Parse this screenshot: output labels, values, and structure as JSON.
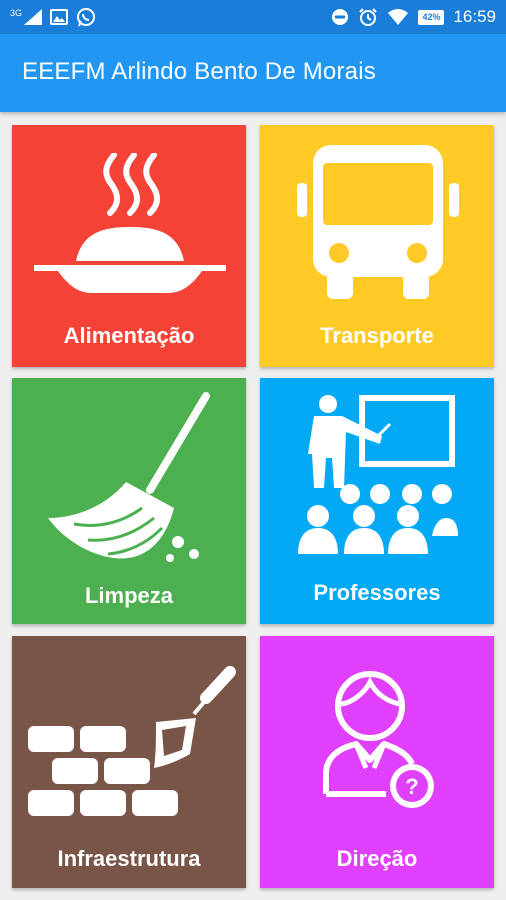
{
  "status_bar": {
    "network": "3G",
    "battery": "42%",
    "time": "16:59",
    "icons": [
      "signal-icon",
      "image-notification-icon",
      "whatsapp-icon",
      "do-not-disturb-icon",
      "alarm-icon",
      "wifi-icon",
      "battery-icon"
    ]
  },
  "app_bar": {
    "title": "EEEFM Arlindo Bento De Morais",
    "color": "#2196f3"
  },
  "tiles": [
    {
      "label": "Alimentação",
      "color": "#f44336",
      "icon": "food-plate-icon"
    },
    {
      "label": "Transporte",
      "color": "#ffc926",
      "icon": "bus-icon"
    },
    {
      "label": "Limpeza",
      "color": "#4caf50",
      "icon": "broom-icon"
    },
    {
      "label": "Professores",
      "color": "#03a9f4",
      "icon": "teacher-class-icon"
    },
    {
      "label": "Infraestrutura",
      "color": "#795548",
      "icon": "bricks-trowel-icon"
    },
    {
      "label": "Direção",
      "color": "#e040fb",
      "icon": "director-question-icon"
    }
  ]
}
